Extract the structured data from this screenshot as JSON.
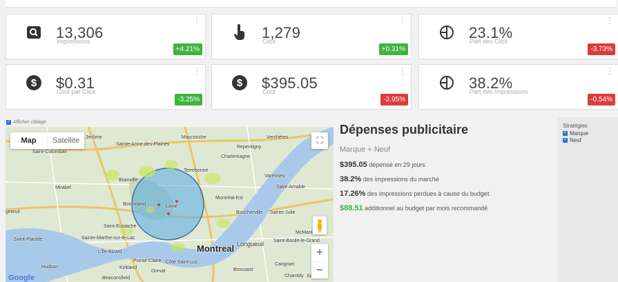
{
  "cards": [
    {
      "value": "13,306",
      "label": "Impressions",
      "badge": "+4.21%",
      "trend": "up",
      "icon": "search-icon"
    },
    {
      "value": "1,279",
      "label": "Clics",
      "badge": "+0.31%",
      "trend": "up",
      "icon": "pointer-hand-icon"
    },
    {
      "value": "23.1%",
      "label": "Part des Clics",
      "badge": "-3.73%",
      "trend": "down",
      "icon": "pie-chart-icon"
    },
    {
      "value": "$0.31",
      "label": "Coût par Click",
      "badge": "-3.25%",
      "trend": "up",
      "icon": "dollar-icon"
    },
    {
      "value": "$395.05",
      "label": "Coût",
      "badge": "-2.95%",
      "trend": "down",
      "icon": "dollar-icon"
    },
    {
      "value": "38.2%",
      "label": "Part des Impressions",
      "badge": "-0.54%",
      "trend": "down",
      "icon": "pie-chart-icon"
    }
  ],
  "ciblage": {
    "label": "Afficher ciblage",
    "checked": true
  },
  "map": {
    "toggle_map": "Map",
    "toggle_satellite": "Satellite",
    "google": "Google",
    "labels": [
      "Jérôme",
      "Mascouche",
      "Verchères",
      "Sainte-Anne-des-Plaines",
      "Repentigny",
      "Saint-Colomban",
      "Charlemagne",
      "Terrebonne",
      "Blainville",
      "Varennes",
      "Mirabel",
      "Saint-Amable",
      "Boisbriand",
      "Laval",
      "Montréal-Est",
      "geteuil",
      "Boucherville",
      "Sainte-Julie",
      "Saint-Eustache",
      "McMasterville",
      "Sainte-Marthe-sur-le-Lac",
      "Saint-Placide",
      "Longueuil",
      "Saint-Basile-le-Grand",
      "Montreal",
      "L'Île-Bizard",
      "Pointe-Claire",
      "Côte Saint-Luc",
      "Brossard",
      "Carignan",
      "Hudson",
      "Kirkland",
      "Dorval",
      "Beaconsfield",
      "Chambly",
      "Saint"
    ],
    "zoom_in": "+",
    "zoom_out": "−"
  },
  "info": {
    "title": "Dépenses publicitaire",
    "subtitle": "Marque + Neuf",
    "rows": [
      {
        "value": "$395.05",
        "text": "dépensé en 29 jours"
      },
      {
        "value": "38.2%",
        "text": "des impressions du marché"
      },
      {
        "value": "17.26%",
        "text": "des impressions perdues à cause du budget"
      },
      {
        "value": "$88.51",
        "text": "additionnel au budget par mois recommandé"
      }
    ]
  },
  "strategies": {
    "header": "Stratégies",
    "options": [
      {
        "label": "Marque",
        "checked": true
      },
      {
        "label": "Neuf",
        "checked": true
      }
    ]
  },
  "colors": {
    "up": "#3fb43f",
    "down": "#dd3b3b",
    "accent_green": "#3cb043",
    "check": "#2f6fcf"
  }
}
